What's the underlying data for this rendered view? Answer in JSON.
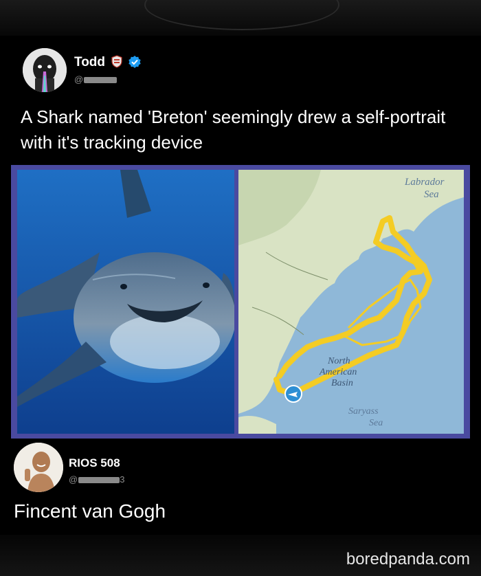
{
  "post": {
    "author": {
      "name": "Todd",
      "handle_prefix": "@",
      "shield_icon": "shield-emoji-icon",
      "verified_icon": "verified-badge-icon"
    },
    "text": "A Shark named 'Breton' seemingly drew a self-portrait with it's tracking device",
    "map_labels": {
      "sea_1": "Labrador",
      "sea_1b": "Sea",
      "basin_1": "North",
      "basin_2": "American",
      "basin_3": "Basin",
      "sea_2": "Saryass",
      "sea_2b": "Sea"
    }
  },
  "reply": {
    "author": {
      "name": "RIOS 508",
      "handle_prefix": "@",
      "handle_suffix": "3"
    },
    "text": "Fincent van Gogh"
  },
  "watermark": "boredpanda.com",
  "colors": {
    "background": "#000000",
    "frame": "#4a4aa0",
    "track": "#f4cc24",
    "ocean": "#9ec3dd",
    "verified": "#1d9bf0"
  }
}
